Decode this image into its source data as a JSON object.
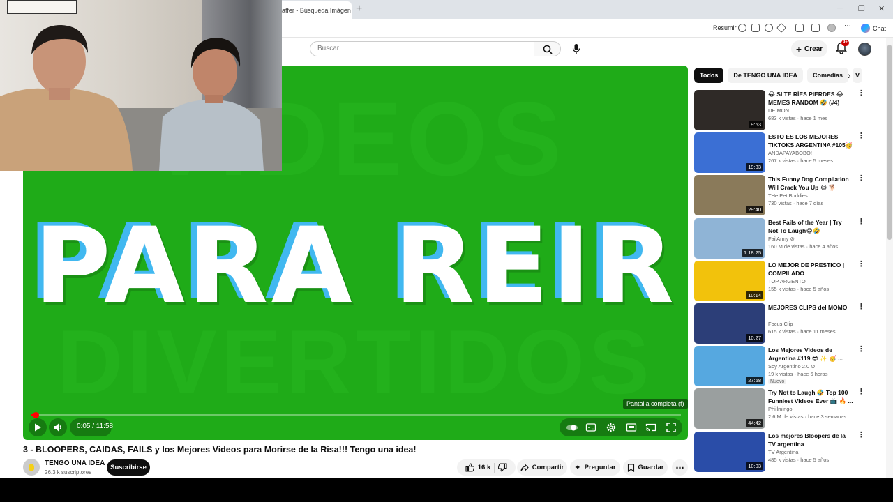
{
  "browser": {
    "tab_title": "affer - Búsqueda Imágen",
    "tab_close": "✕",
    "new_tab": "+",
    "win_min": "─",
    "win_max": "❐",
    "win_close": "✕",
    "resumir_label": "Resumir",
    "chat_label": "Chat"
  },
  "header": {
    "search_placeholder": "Buscar",
    "create_label": "Crear",
    "notif_badge": "9+"
  },
  "player": {
    "ghost_top": "VIDEOS",
    "main_text": "PARA REIR",
    "ghost_bottom": "DIVERTIDOS",
    "time": "0:05 / 11:58",
    "tooltip": "Pantalla completa (f)",
    "progress_fraction": 0.007
  },
  "video": {
    "title": "3 - BLOOPERS, CAIDAS, FAILS y los Mejores Videos para Morirse de la Risa!!! Tengo una idea!",
    "channel": "TENGO UNA IDEA",
    "subs": "26.3 k suscriptores",
    "subscribe": "Suscribirse",
    "likes": "16 k",
    "share": "Compartir",
    "ask": "Preguntar",
    "save": "Guardar"
  },
  "sidebar": {
    "chips": [
      "Todos",
      "De TENGO UNA IDEA",
      "Comedias",
      "V"
    ],
    "items": [
      {
        "title": "😂 SI TE RÍES PIERDES 😂 MEMES RANDOM 🤣 (#4)",
        "channel": "DEIMON",
        "meta": "683 k vistas · hace 1 mes",
        "duration": "9:53",
        "thumb": "#2f2a27",
        "badge": ""
      },
      {
        "title": "ESTO ES LOS MEJORES TIKTOKS ARGENTINA #105🥳",
        "channel": "ANDAPAYABOBO!",
        "meta": "267 k vistas · hace 5 meses",
        "duration": "19:33",
        "thumb": "#3b6fd4",
        "badge": ""
      },
      {
        "title": "This Funny Dog Compilation Will Crack You Up 😂 🐕 Funniest ...",
        "channel": "THe Pet Buddies",
        "meta": "730 vistas · hace 7 días",
        "duration": "29:40",
        "thumb": "#8a7a5a",
        "badge": ""
      },
      {
        "title": "Best Fails of the Year | Try Not To Laugh😂🤣",
        "channel": "FailArmy ⊘",
        "meta": "160 M de vistas · hace 4 años",
        "duration": "1:18:25",
        "thumb": "#8fb4d6",
        "badge": ""
      },
      {
        "title": "LO MEJOR DE PRESTICO | COMPILADO",
        "channel": "TOP ARGENTO",
        "meta": "155 k vistas · hace 5 años",
        "duration": "10:14",
        "thumb": "#f2c20c",
        "badge": ""
      },
      {
        "title": "MEJORES CLIPS del MOMO",
        "channel": "Focus Clip",
        "meta": "615 k vistas · hace 11 meses",
        "duration": "10:27",
        "thumb": "#2c3e78",
        "badge": ""
      },
      {
        "title": "Los Mejores Videos de Argentina #119 😎 ✨ 🥳 ...",
        "channel": "Soy Argentino 2.0 ⊘",
        "meta": "19 k vistas · hace 6 horas",
        "duration": "27:58",
        "thumb": "#56a8e0",
        "badge": "Nuevo"
      },
      {
        "title": "Try Not to Laugh 🤣 Top 100 Funniest Videos Ever 📺 🔥 ...",
        "channel": "Phillmingo",
        "meta": "2.6 M de vistas · hace 3 semanas",
        "duration": "44:42",
        "thumb": "#9a9f9f",
        "badge": ""
      },
      {
        "title": "Los mejores Bloopers de la TV argentina",
        "channel": "TV Argentina",
        "meta": "485 k vistas · hace 5 años",
        "duration": "10:03",
        "thumb": "#2a4da8",
        "badge": ""
      }
    ]
  }
}
